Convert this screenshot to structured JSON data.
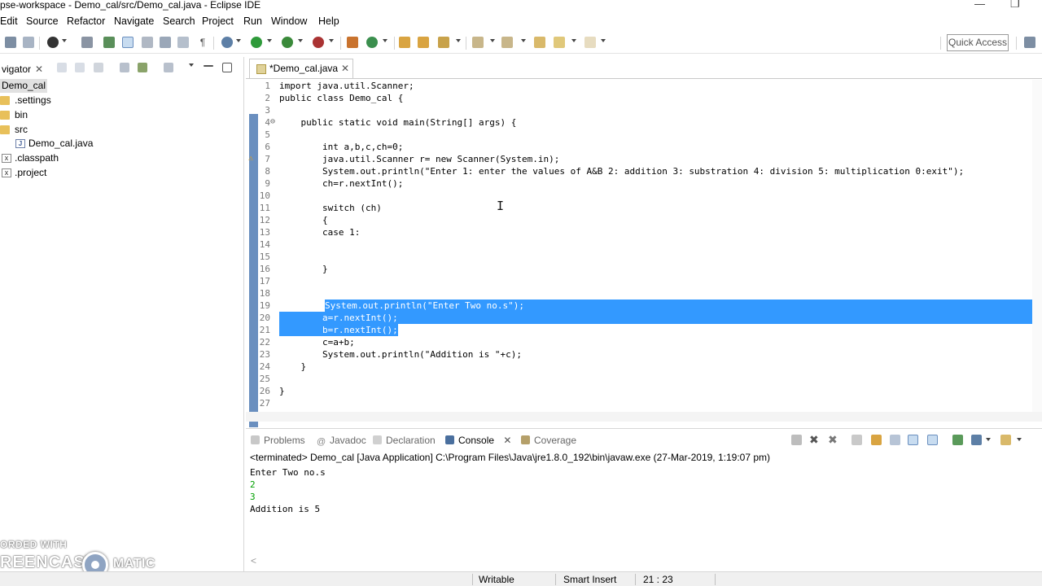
{
  "window": {
    "title": "pse-workspace - Demo_cal/src/Demo_cal.java - Eclipse IDE",
    "minimize": "—",
    "restore": "❐"
  },
  "menu": [
    "Edit",
    "Source",
    "Refactor",
    "Navigate",
    "Search",
    "Project",
    "Run",
    "Window",
    "Help"
  ],
  "toolbar": {
    "quick_access": "Quick Access"
  },
  "navigator": {
    "tab_label": "vigator",
    "tree": [
      {
        "label": "Demo_cal",
        "icon": "project-icon",
        "selected": true
      },
      {
        "label": ".settings",
        "icon": "folder-icon"
      },
      {
        "label": "bin",
        "icon": "folder-icon"
      },
      {
        "label": "src",
        "icon": "folder-icon"
      },
      {
        "label": "Demo_cal.java",
        "icon": "java-file-icon"
      },
      {
        "label": ".classpath",
        "icon": "xml-file-icon"
      },
      {
        "label": ".project",
        "icon": "xml-file-icon"
      }
    ]
  },
  "editor": {
    "tab_label": "*Demo_cal.java",
    "lines": [
      {
        "n": "1",
        "text": "import java.util.Scanner;"
      },
      {
        "n": "2",
        "text": "public class Demo_cal {"
      },
      {
        "n": "3",
        "text": ""
      },
      {
        "n": "4",
        "text": "    public static void main(String[] args) {"
      },
      {
        "n": "5",
        "text": ""
      },
      {
        "n": "6",
        "text": "        int a,b,c,ch=0;"
      },
      {
        "n": "7",
        "text": "        java.util.Scanner r= new Scanner(System.in);"
      },
      {
        "n": "8",
        "text": "        System.out.println(\"Enter 1: enter the values of A&B 2: addition 3: substration 4: division 5: multiplication 0:exit\");"
      },
      {
        "n": "9",
        "text": "        ch=r.nextInt();"
      },
      {
        "n": "10",
        "text": ""
      },
      {
        "n": "11",
        "text": "        switch (ch)"
      },
      {
        "n": "12",
        "text": "        {"
      },
      {
        "n": "13",
        "text": "        case 1:"
      },
      {
        "n": "14",
        "text": ""
      },
      {
        "n": "15",
        "text": ""
      },
      {
        "n": "16",
        "text": "        }"
      },
      {
        "n": "17",
        "text": ""
      },
      {
        "n": "18",
        "text": ""
      },
      {
        "n": "19",
        "text": "        System.out.println(\"Enter Two no.s\");",
        "selected": "partial-start"
      },
      {
        "n": "20",
        "text": "        a=r.nextInt();",
        "selected": "full"
      },
      {
        "n": "21",
        "text": "        b=r.nextInt();",
        "selected": "partial-end"
      },
      {
        "n": "22",
        "text": "        c=a+b;"
      },
      {
        "n": "23",
        "text": "        System.out.println(\"Addition is \"+c);"
      },
      {
        "n": "24",
        "text": "    }"
      },
      {
        "n": "25",
        "text": ""
      },
      {
        "n": "26",
        "text": "}"
      },
      {
        "n": "27",
        "text": ""
      }
    ]
  },
  "console": {
    "tabs": [
      {
        "label": "Problems",
        "active": false
      },
      {
        "label": "Javadoc",
        "active": false
      },
      {
        "label": "Declaration",
        "active": false
      },
      {
        "label": "Console",
        "active": true
      },
      {
        "label": "Coverage",
        "active": false
      }
    ],
    "header": "<terminated> Demo_cal [Java Application] C:\\Program Files\\Java\\jre1.8.0_192\\bin\\javaw.exe (27-Mar-2019, 1:19:07 pm)",
    "output": [
      {
        "text": "Enter Two no.s",
        "color": "#000000"
      },
      {
        "text": "2",
        "color": "#00a000"
      },
      {
        "text": "3",
        "color": "#00a000"
      },
      {
        "text": "Addition is 5",
        "color": "#000000"
      }
    ]
  },
  "status": {
    "writable": "Writable",
    "insert_mode": "Smart Insert",
    "position": "21 : 23"
  },
  "watermark": {
    "line1": "ORDED WITH",
    "line2": "REENCAST",
    "line3": "MATIC"
  }
}
